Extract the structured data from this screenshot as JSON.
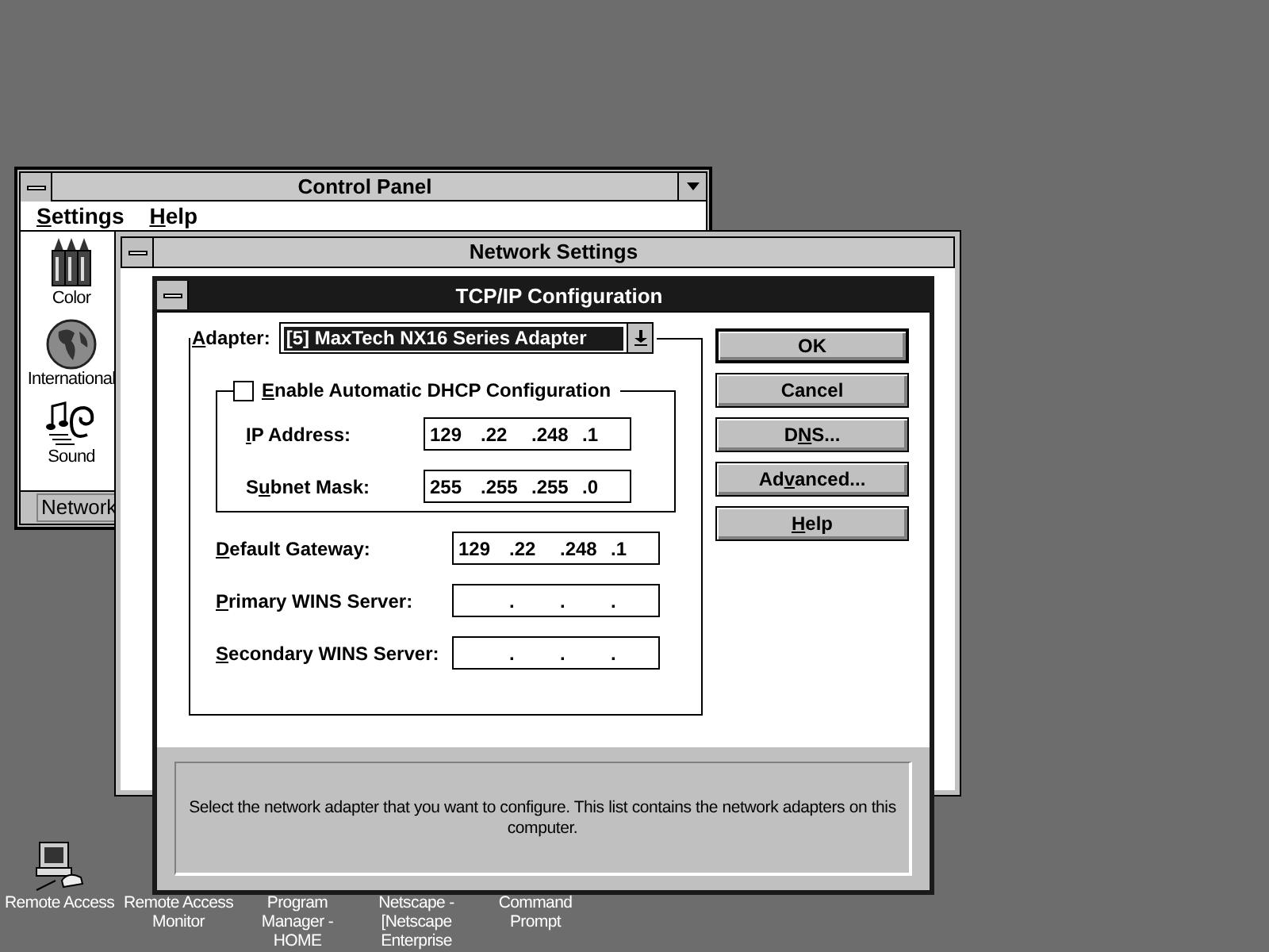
{
  "control_panel": {
    "title": "Control Panel",
    "menu": [
      {
        "key": "S",
        "post": "ettings"
      },
      {
        "key": "H",
        "post": "elp"
      }
    ],
    "icons": [
      {
        "kind": "color",
        "label": "Color"
      },
      {
        "kind": "globe",
        "label": "International"
      },
      {
        "kind": "sound",
        "label": "Sound"
      }
    ],
    "status": "Network"
  },
  "network_settings": {
    "title": "Network Settings"
  },
  "dialog": {
    "title": "TCP/IP Configuration",
    "adapter": {
      "label": {
        "key": "A",
        "post": "dapter:"
      },
      "value": "[5] MaxTech NX16 Series Adapter"
    },
    "dhcp": {
      "label": {
        "key": "E",
        "post": "nable Automatic DHCP Configuration"
      },
      "checked": false
    },
    "dhcp_fields": [
      {
        "label": {
          "key": "I",
          "post": "P Address:"
        },
        "octets": [
          "129",
          ".22",
          ".248",
          ".1"
        ]
      },
      {
        "label": {
          "pre": "S",
          "key": "u",
          "post": "bnet Mask:"
        },
        "octets": [
          "255",
          ".255",
          ".255",
          ".0"
        ]
      }
    ],
    "fields": [
      {
        "label": {
          "key": "D",
          "post": "efault Gateway:"
        },
        "octets": [
          "129",
          ".22",
          ".248",
          ".1"
        ]
      },
      {
        "label": {
          "key": "P",
          "post": "rimary WINS Server:"
        },
        "octets": [
          ".",
          ".",
          "."
        ]
      },
      {
        "label": {
          "key": "S",
          "post": "econdary WINS Server:"
        },
        "octets": [
          ".",
          ".",
          "."
        ]
      }
    ],
    "buttons": [
      {
        "pre": "OK"
      },
      {
        "pre": "Cancel"
      },
      {
        "pre": "D",
        "key": "N",
        "post": "S..."
      },
      {
        "pre": "Ad",
        "key": "v",
        "post": "anced..."
      },
      {
        "key": "H",
        "post": "elp"
      }
    ],
    "hint": "Select the network adapter that you want to configure. This list contains the network adapters on this computer."
  },
  "desktop_icons": [
    {
      "kind": "computer",
      "label": "Remote Access"
    },
    {
      "kind": "hidden",
      "label": "Remote Access Monitor"
    },
    {
      "kind": "hidden",
      "label": "Program Manager - HOME"
    },
    {
      "kind": "hidden",
      "label": "Netscape - [Netscape Enterprise"
    },
    {
      "kind": "hidden",
      "label": "Command Prompt"
    }
  ]
}
